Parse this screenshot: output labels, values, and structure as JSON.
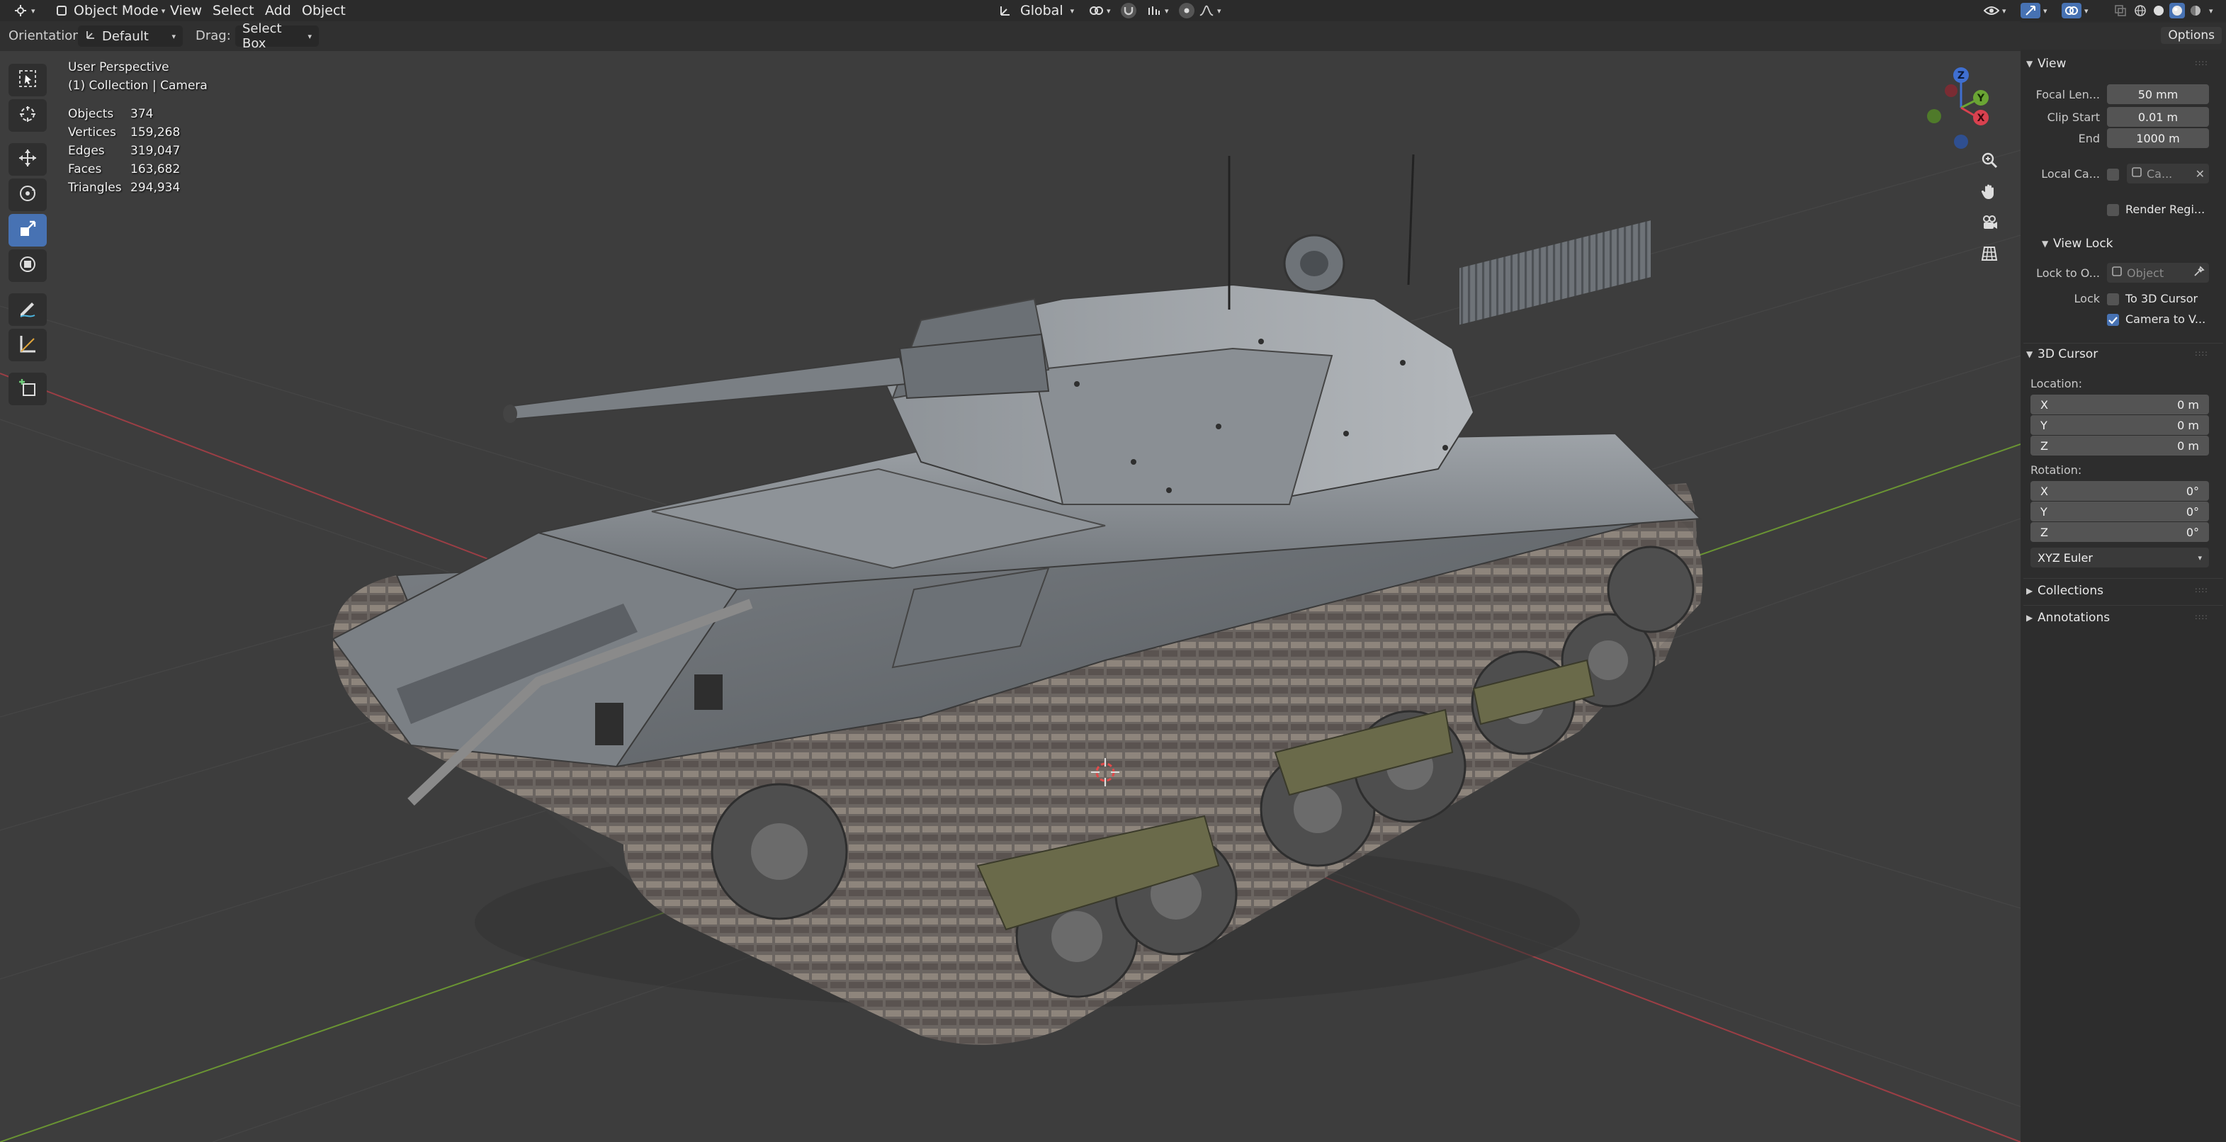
{
  "header": {
    "editor_type_icon": "editor-3d-viewport-icon",
    "mode": "Object Mode",
    "menus": [
      "View",
      "Select",
      "Add",
      "Object"
    ],
    "transform_orientation": "Global"
  },
  "tool_settings": {
    "orientation_label": "Orientation:",
    "orientation_value": "Default",
    "drag_label": "Drag:",
    "drag_value": "Select Box"
  },
  "viewport": {
    "view_name": "User Perspective",
    "collection_info": "(1) Collection | Camera",
    "stats": [
      {
        "label": "Objects",
        "value": "374"
      },
      {
        "label": "Vertices",
        "value": "159,268"
      },
      {
        "label": "Edges",
        "value": "319,047"
      },
      {
        "label": "Faces",
        "value": "163,682"
      },
      {
        "label": "Triangles",
        "value": "294,934"
      }
    ],
    "gizmo_axes": [
      "Z",
      "Y",
      "X"
    ],
    "nav_buttons": [
      "zoom-icon",
      "hand-pan-icon",
      "camera-view-icon",
      "grid-ortho-icon"
    ],
    "tools": [
      "select-box-icon",
      "cursor-icon",
      "move-icon",
      "rotate-icon",
      "scale-icon",
      "transform-icon",
      "annotate-icon",
      "measure-icon",
      "add-cube-icon"
    ],
    "active_tool": "scale-icon",
    "colors": {
      "bg": "#3d3d3d",
      "grid": "#474747",
      "x_axis": "#b8434c",
      "y_axis": "#74a33b",
      "accent": "#4772b3"
    }
  },
  "npanel": {
    "options_label": "Options",
    "view": {
      "title": "View",
      "focal_length_label": "Focal Len...",
      "focal_length_value": "50 mm",
      "clip_start_label": "Clip Start",
      "clip_start_value": "0.01 m",
      "clip_end_label": "End",
      "clip_end_value": "1000 m",
      "local_camera_label": "Local Ca...",
      "local_camera_value": "Ca...",
      "render_region_label": "Render Regi..."
    },
    "view_lock": {
      "title": "View Lock",
      "lock_to_object_label": "Lock to O...",
      "lock_to_object_placeholder": "Object",
      "lock_label": "Lock",
      "to_3d_cursor_label": "To 3D Cursor",
      "to_3d_cursor_checked": false,
      "camera_to_view_label": "Camera to V...",
      "camera_to_view_checked": true
    },
    "cursor": {
      "title": "3D Cursor",
      "location_label": "Location:",
      "location": [
        {
          "axis": "X",
          "value": "0 m"
        },
        {
          "axis": "Y",
          "value": "0 m"
        },
        {
          "axis": "Z",
          "value": "0 m"
        }
      ],
      "rotation_label": "Rotation:",
      "rotation": [
        {
          "axis": "X",
          "value": "0°"
        },
        {
          "axis": "Y",
          "value": "0°"
        },
        {
          "axis": "Z",
          "value": "0°"
        }
      ],
      "rotation_mode": "XYZ Euler"
    },
    "collections_title": "Collections",
    "annotations_title": "Annotations"
  }
}
